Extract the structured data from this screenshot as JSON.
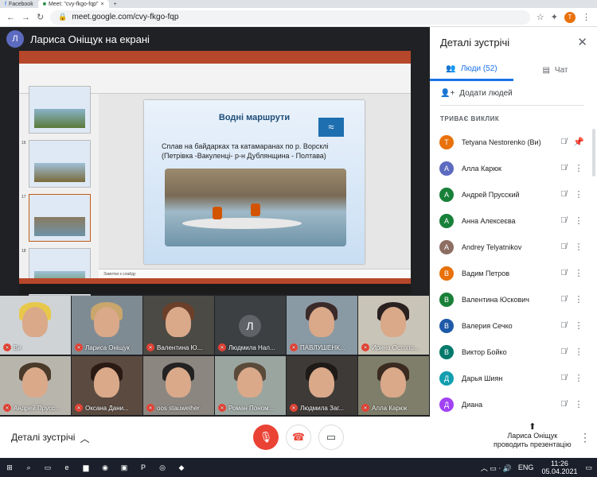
{
  "browser": {
    "tabs": [
      "Facebook",
      "Meet: \"cvy-fkgo-fqp\""
    ],
    "url": "meet.google.com/cvy-fkgo-fqp",
    "profile_letter": "T"
  },
  "meet": {
    "presenter_initial": "Л",
    "presenter_header": "Лариса Оніщук на екрані"
  },
  "slide": {
    "title": "Водні маршрути",
    "text": "Сплав на байдарках та катамаранах по р. Ворсклі (Петрівка -Вакуленці- р-н Дублянщина - Полтава)",
    "notes": "Заметки к слайду",
    "thumb_numbers": [
      "16",
      "17",
      "18"
    ]
  },
  "tiles": [
    {
      "name": "Ви",
      "hair": "#e7c84a",
      "bg": "#cfd3d6"
    },
    {
      "name": "Лариса Оніщук",
      "hair": "#c9a66b",
      "bg": "#7f8b93"
    },
    {
      "name": "Валентина Ю...",
      "hair": "#6b3f2a",
      "bg": "#4b4a45"
    },
    {
      "name": "Людмила Нал...",
      "letter": "Л",
      "bg": "#3c4043"
    },
    {
      "name": "ПАВЛУШЕНК...",
      "hair": "#3b2a2a",
      "bg": "#8a9aa4"
    },
    {
      "name": "Ирина Остопо...",
      "hair": "#2a2020",
      "bg": "#c9c4b8"
    },
    {
      "name": "Андрей Прусс...",
      "hair": "#4a3a2a",
      "bg": "#b8b5ad"
    },
    {
      "name": "Оксана Дани...",
      "hair": "#2a1a14",
      "bg": "#5a4a40"
    },
    {
      "name": "oos stauweiher",
      "hair": "#222",
      "bg": "#8b8680"
    },
    {
      "name": "Роман Поном...",
      "hair": "#5a4a3a",
      "bg": "#9aa5a0"
    },
    {
      "name": "Людмила Заг...",
      "hair": "#1e1a18",
      "bg": "#3d3a38"
    },
    {
      "name": "Алла Карюк",
      "hair": "#3a2a20",
      "bg": "#7e7e6a"
    }
  ],
  "panel": {
    "title": "Деталі зустрічі",
    "tab_people": "Люди (52)",
    "tab_chat": "Чат",
    "add_people": "Додати людей",
    "section": "ТРИВАЄ ВИКЛИК",
    "participants": [
      {
        "initial": "T",
        "name": "Tetyana Nestorenko (Ви)",
        "color": "#e8710a"
      },
      {
        "initial": "А",
        "name": "Алла Карюк",
        "color": "#5c6bc0"
      },
      {
        "initial": "А",
        "name": "Андрей Прусский",
        "color": "#188038"
      },
      {
        "initial": "А",
        "name": "Анна Алексеєва",
        "color": "#188038"
      },
      {
        "initial": "A",
        "name": "Andrey Telyatnikov",
        "color": "#8d6e63"
      },
      {
        "initial": "В",
        "name": "Вадим Петров",
        "color": "#e8710a"
      },
      {
        "initial": "В",
        "name": "Валентина Юскович",
        "color": "#188038"
      },
      {
        "initial": "В",
        "name": "Валерия Сечко",
        "color": "#1e5aa8"
      },
      {
        "initial": "В",
        "name": "Виктор Бойко",
        "color": "#00796b"
      },
      {
        "initial": "Д",
        "name": "Дарья Шиян",
        "color": "#129eaf"
      },
      {
        "initial": "Д",
        "name": "Диана",
        "color": "#a142f4"
      }
    ]
  },
  "bottom": {
    "details": "Деталі зустрічі",
    "presenting_name": "Лариса Оніщук",
    "presenting_label": "проводить презентацію"
  },
  "taskbar": {
    "lang": "ENG",
    "time": "11:26",
    "date": "05.04.2021"
  }
}
